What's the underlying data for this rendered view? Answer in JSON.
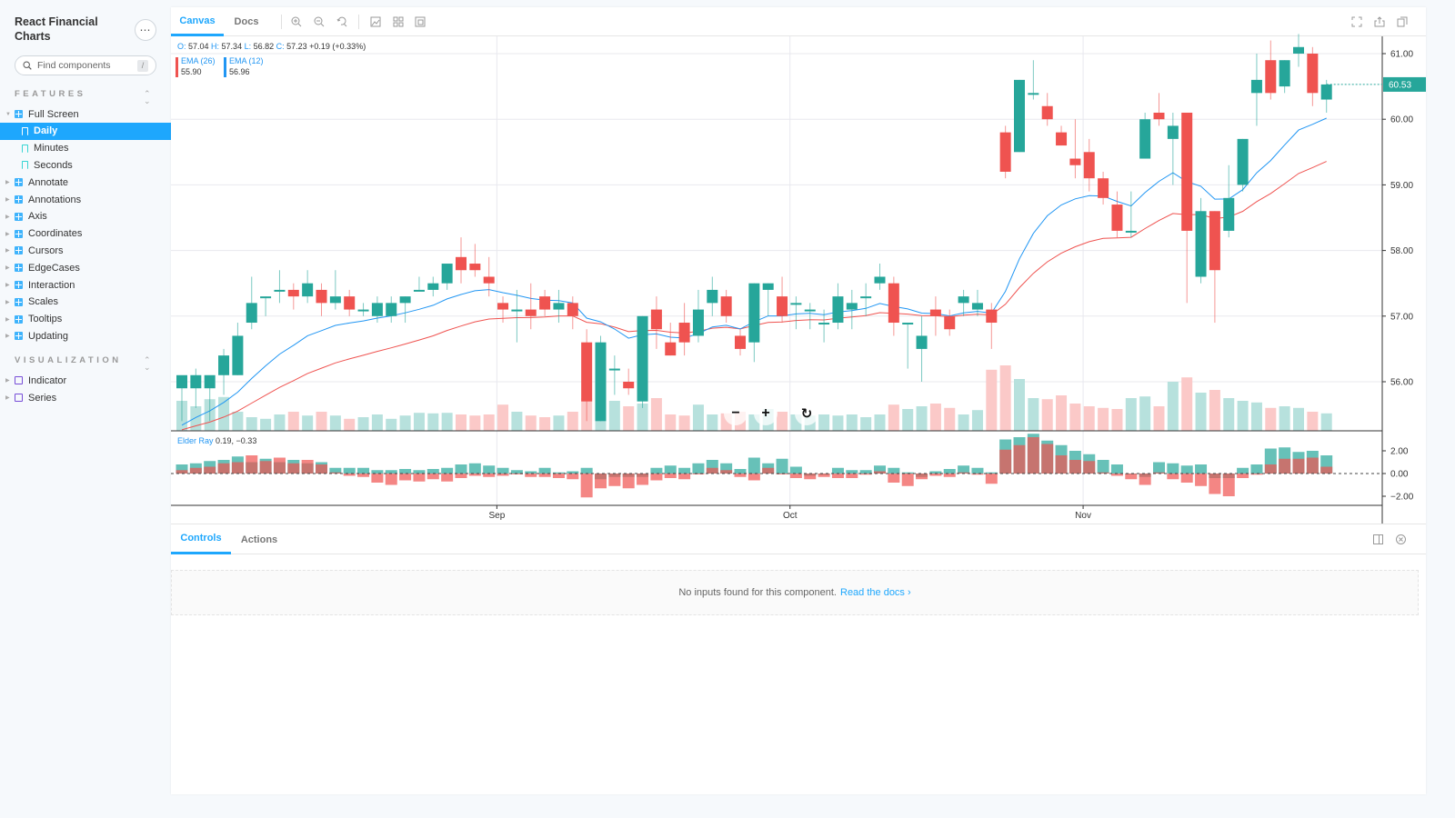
{
  "app": {
    "title": "React Financial Charts",
    "more_label": "⋯",
    "search_placeholder": "Find components",
    "search_shortcut": "/"
  },
  "sidebar": {
    "sections": [
      {
        "title": "FEATURES",
        "items": [
          {
            "label": "Full Screen",
            "type": "component",
            "expanded": true,
            "children": [
              {
                "label": "Daily",
                "type": "story",
                "active": true
              },
              {
                "label": "Minutes",
                "type": "story",
                "active": false
              },
              {
                "label": "Seconds",
                "type": "story",
                "active": false
              }
            ]
          },
          {
            "label": "Annotate",
            "type": "component"
          },
          {
            "label": "Annotations",
            "type": "component"
          },
          {
            "label": "Axis",
            "type": "component"
          },
          {
            "label": "Coordinates",
            "type": "component"
          },
          {
            "label": "Cursors",
            "type": "component"
          },
          {
            "label": "EdgeCases",
            "type": "component"
          },
          {
            "label": "Interaction",
            "type": "component"
          },
          {
            "label": "Scales",
            "type": "component"
          },
          {
            "label": "Tooltips",
            "type": "component"
          },
          {
            "label": "Updating",
            "type": "component"
          }
        ]
      },
      {
        "title": "VISUALIZATION",
        "items": [
          {
            "label": "Indicator",
            "type": "folder"
          },
          {
            "label": "Series",
            "type": "folder"
          }
        ]
      }
    ]
  },
  "toolbar": {
    "tabs": [
      {
        "label": "Canvas",
        "active": true
      },
      {
        "label": "Docs",
        "active": false
      }
    ],
    "icons": [
      "zoom-in-icon",
      "zoom-out-icon",
      "reset-zoom-icon",
      "background-icon",
      "grid-icon",
      "outline-icon"
    ],
    "right_icons": [
      "fullscreen-icon",
      "share-icon",
      "copy-icon"
    ]
  },
  "addons": {
    "tabs": [
      {
        "label": "Controls",
        "active": true
      },
      {
        "label": "Actions",
        "active": false
      }
    ],
    "empty_text": "No inputs found for this component.",
    "docs_link": "Read the docs",
    "docs_chevron": "›"
  },
  "colors": {
    "up": "#26a69a",
    "down": "#ef5350",
    "up_volume": "#b7e1dd",
    "down_volume": "#fbc9c8",
    "ema12": "#2196f3",
    "ema26": "#ef5350",
    "accent": "#1ea7fd"
  },
  "chart_data": {
    "type": "candlestick",
    "title": "",
    "ohlc_tooltip": {
      "o_label": "O:",
      "o": "57.04",
      "h_label": "H:",
      "h": "57.34",
      "l_label": "L:",
      "l": "56.82",
      "c_label": "C:",
      "c": "57.23",
      "change": "+0.19 (+0.33%)"
    },
    "legend": [
      {
        "name": "EMA (26)",
        "value": "55.90",
        "color": "#ef5350"
      },
      {
        "name": "EMA (12)",
        "value": "56.96",
        "color": "#2196f3"
      }
    ],
    "last_price_label": "60.53",
    "y_ticks": [
      "56.00",
      "57.00",
      "58.00",
      "59.00",
      "60.00",
      "61.00"
    ],
    "ylim": [
      55.3,
      61.25
    ],
    "x_ticks": [
      {
        "label": "Sep",
        "index": 23
      },
      {
        "label": "Oct",
        "index": 44
      },
      {
        "label": "Nov",
        "index": 65
      }
    ],
    "elder_ray": {
      "label": "Elder Ray",
      "values": "0.19, −0.33",
      "y_ticks": [
        "2.00",
        "0.00",
        "−2.00"
      ],
      "ylim": [
        -3.0,
        3.1
      ]
    },
    "candles": [
      {
        "o": 55.9,
        "h": 56.0,
        "l": 55.4,
        "c": 56.1
      },
      {
        "o": 55.9,
        "h": 56.2,
        "l": 55.6,
        "c": 56.1
      },
      {
        "o": 55.9,
        "h": 56.0,
        "l": 55.4,
        "c": 56.1
      },
      {
        "o": 56.1,
        "h": 56.5,
        "l": 55.8,
        "c": 56.4
      },
      {
        "o": 56.1,
        "h": 56.9,
        "l": 56.1,
        "c": 56.7
      },
      {
        "o": 56.9,
        "h": 57.6,
        "l": 56.8,
        "c": 57.2
      },
      {
        "o": 57.3,
        "h": 57.3,
        "l": 57.0,
        "c": 57.3
      },
      {
        "o": 57.4,
        "h": 57.7,
        "l": 57.2,
        "c": 57.4
      },
      {
        "o": 57.4,
        "h": 57.5,
        "l": 57.1,
        "c": 57.3
      },
      {
        "o": 57.3,
        "h": 57.7,
        "l": 57.2,
        "c": 57.5
      },
      {
        "o": 57.4,
        "h": 57.5,
        "l": 57.0,
        "c": 57.2
      },
      {
        "o": 57.2,
        "h": 57.7,
        "l": 57.1,
        "c": 57.3
      },
      {
        "o": 57.3,
        "h": 57.4,
        "l": 57.0,
        "c": 57.1
      },
      {
        "o": 57.1,
        "h": 57.2,
        "l": 57.0,
        "c": 57.1
      },
      {
        "o": 57.0,
        "h": 57.3,
        "l": 56.9,
        "c": 57.2
      },
      {
        "o": 57.0,
        "h": 57.3,
        "l": 56.9,
        "c": 57.2
      },
      {
        "o": 57.2,
        "h": 57.3,
        "l": 56.9,
        "c": 57.3
      },
      {
        "o": 57.4,
        "h": 57.6,
        "l": 57.4,
        "c": 57.4
      },
      {
        "o": 57.4,
        "h": 57.6,
        "l": 57.3,
        "c": 57.5
      },
      {
        "o": 57.5,
        "h": 57.8,
        "l": 57.4,
        "c": 57.8
      },
      {
        "o": 57.9,
        "h": 58.2,
        "l": 57.5,
        "c": 57.7
      },
      {
        "o": 57.8,
        "h": 58.1,
        "l": 57.6,
        "c": 57.7
      },
      {
        "o": 57.6,
        "h": 57.9,
        "l": 57.3,
        "c": 57.5
      },
      {
        "o": 57.2,
        "h": 57.3,
        "l": 56.9,
        "c": 57.1
      },
      {
        "o": 57.1,
        "h": 57.4,
        "l": 56.6,
        "c": 57.1
      },
      {
        "o": 57.1,
        "h": 57.5,
        "l": 56.8,
        "c": 57.0
      },
      {
        "o": 57.3,
        "h": 57.4,
        "l": 57.0,
        "c": 57.1
      },
      {
        "o": 57.1,
        "h": 57.4,
        "l": 56.9,
        "c": 57.2
      },
      {
        "o": 57.2,
        "h": 57.3,
        "l": 56.8,
        "c": 57.0
      },
      {
        "o": 56.6,
        "h": 56.8,
        "l": 55.4,
        "c": 55.7
      },
      {
        "o": 55.4,
        "h": 56.7,
        "l": 55.4,
        "c": 56.6
      },
      {
        "o": 56.2,
        "h": 56.4,
        "l": 55.8,
        "c": 56.2
      },
      {
        "o": 56.0,
        "h": 56.2,
        "l": 55.8,
        "c": 55.9
      },
      {
        "o": 55.7,
        "h": 57.0,
        "l": 55.6,
        "c": 57.0
      },
      {
        "o": 57.1,
        "h": 57.3,
        "l": 56.5,
        "c": 56.8
      },
      {
        "o": 56.6,
        "h": 56.9,
        "l": 56.4,
        "c": 56.4
      },
      {
        "o": 56.9,
        "h": 57.2,
        "l": 56.4,
        "c": 56.6
      },
      {
        "o": 56.7,
        "h": 57.4,
        "l": 56.6,
        "c": 57.1
      },
      {
        "o": 57.2,
        "h": 57.6,
        "l": 57.0,
        "c": 57.4
      },
      {
        "o": 57.3,
        "h": 57.4,
        "l": 56.9,
        "c": 57.0
      },
      {
        "o": 56.7,
        "h": 56.8,
        "l": 56.4,
        "c": 56.5
      },
      {
        "o": 56.6,
        "h": 57.5,
        "l": 56.3,
        "c": 57.5
      },
      {
        "o": 57.4,
        "h": 57.5,
        "l": 57.0,
        "c": 57.5
      },
      {
        "o": 57.3,
        "h": 57.6,
        "l": 56.9,
        "c": 57.0
      },
      {
        "o": 57.2,
        "h": 57.3,
        "l": 56.8,
        "c": 57.2
      },
      {
        "o": 57.1,
        "h": 57.2,
        "l": 56.8,
        "c": 57.1
      },
      {
        "o": 56.9,
        "h": 57.1,
        "l": 56.6,
        "c": 56.9
      },
      {
        "o": 56.9,
        "h": 57.5,
        "l": 56.8,
        "c": 57.3
      },
      {
        "o": 57.1,
        "h": 57.4,
        "l": 56.8,
        "c": 57.2
      },
      {
        "o": 57.3,
        "h": 57.5,
        "l": 57.0,
        "c": 57.3
      },
      {
        "o": 57.5,
        "h": 57.8,
        "l": 57.4,
        "c": 57.6
      },
      {
        "o": 57.5,
        "h": 57.6,
        "l": 56.7,
        "c": 56.9
      },
      {
        "o": 56.9,
        "h": 56.9,
        "l": 56.2,
        "c": 56.9
      },
      {
        "o": 56.5,
        "h": 57.0,
        "l": 56.0,
        "c": 56.7
      },
      {
        "o": 57.1,
        "h": 57.3,
        "l": 56.7,
        "c": 57.0
      },
      {
        "o": 57.0,
        "h": 57.1,
        "l": 56.7,
        "c": 56.8
      },
      {
        "o": 57.2,
        "h": 57.4,
        "l": 57.0,
        "c": 57.3
      },
      {
        "o": 57.1,
        "h": 57.4,
        "l": 57.0,
        "c": 57.2
      },
      {
        "o": 57.1,
        "h": 57.2,
        "l": 56.5,
        "c": 56.9
      },
      {
        "o": 59.8,
        "h": 59.9,
        "l": 59.1,
        "c": 59.2
      },
      {
        "o": 59.5,
        "h": 60.6,
        "l": 59.5,
        "c": 60.6
      },
      {
        "o": 60.4,
        "h": 60.9,
        "l": 60.3,
        "c": 60.4
      },
      {
        "o": 60.2,
        "h": 60.4,
        "l": 59.9,
        "c": 60.0
      },
      {
        "o": 59.8,
        "h": 59.9,
        "l": 59.6,
        "c": 59.6
      },
      {
        "o": 59.4,
        "h": 60.0,
        "l": 59.1,
        "c": 59.3
      },
      {
        "o": 59.5,
        "h": 59.7,
        "l": 58.9,
        "c": 59.1
      },
      {
        "o": 59.1,
        "h": 59.2,
        "l": 58.7,
        "c": 58.8
      },
      {
        "o": 58.7,
        "h": 58.9,
        "l": 58.2,
        "c": 58.3
      },
      {
        "o": 58.3,
        "h": 58.9,
        "l": 58.2,
        "c": 58.3
      },
      {
        "o": 59.4,
        "h": 60.1,
        "l": 59.4,
        "c": 60.0
      },
      {
        "o": 60.1,
        "h": 60.4,
        "l": 59.9,
        "c": 60.0
      },
      {
        "o": 59.7,
        "h": 60.1,
        "l": 59.0,
        "c": 59.9
      },
      {
        "o": 60.1,
        "h": 60.1,
        "l": 57.2,
        "c": 58.3
      },
      {
        "o": 57.6,
        "h": 58.8,
        "l": 57.5,
        "c": 58.6
      },
      {
        "o": 58.6,
        "h": 58.6,
        "l": 56.9,
        "c": 57.7
      },
      {
        "o": 58.3,
        "h": 59.3,
        "l": 58.2,
        "c": 58.8
      },
      {
        "o": 59.0,
        "h": 59.7,
        "l": 58.9,
        "c": 59.7
      },
      {
        "o": 60.4,
        "h": 61.0,
        "l": 59.9,
        "c": 60.6
      },
      {
        "o": 60.9,
        "h": 61.2,
        "l": 60.3,
        "c": 60.4
      },
      {
        "o": 60.5,
        "h": 60.9,
        "l": 60.4,
        "c": 60.9
      },
      {
        "o": 61.0,
        "h": 61.3,
        "l": 60.8,
        "c": 61.1
      },
      {
        "o": 61.0,
        "h": 61.1,
        "l": 60.2,
        "c": 60.4
      },
      {
        "o": 60.3,
        "h": 60.6,
        "l": 60.1,
        "c": 60.53
      }
    ],
    "volume": [
      0.55,
      0.45,
      0.58,
      0.62,
      0.35,
      0.25,
      0.22,
      0.3,
      0.35,
      0.28,
      0.35,
      0.28,
      0.22,
      0.25,
      0.3,
      0.22,
      0.28,
      0.33,
      0.32,
      0.33,
      0.3,
      0.28,
      0.3,
      0.48,
      0.35,
      0.28,
      0.25,
      0.28,
      0.35,
      0.6,
      0.5,
      0.55,
      0.45,
      0.5,
      0.6,
      0.3,
      0.28,
      0.48,
      0.3,
      0.32,
      0.35,
      0.3,
      0.4,
      0.35,
      0.3,
      0.28,
      0.3,
      0.28,
      0.3,
      0.25,
      0.3,
      0.48,
      0.4,
      0.45,
      0.5,
      0.42,
      0.3,
      0.38,
      1.12,
      1.2,
      0.95,
      0.6,
      0.58,
      0.65,
      0.5,
      0.45,
      0.42,
      0.4,
      0.6,
      0.63,
      0.45,
      0.9,
      0.98,
      0.7,
      0.75,
      0.6,
      0.55,
      0.52,
      0.42,
      0.45,
      0.42,
      0.35,
      0.32
    ],
    "elder_bull": [
      0.8,
      0.9,
      1.1,
      1.2,
      1.5,
      1.0,
      1.3,
      1.0,
      1.2,
      0.9,
      1.0,
      0.5,
      0.5,
      0.5,
      0.3,
      0.3,
      0.4,
      0.3,
      0.4,
      0.5,
      0.8,
      0.9,
      0.7,
      0.5,
      0.3,
      0.2,
      0.5,
      0.1,
      0.2,
      0.5,
      -0.5,
      -0.3,
      -0.3,
      -0.3,
      0.5,
      0.7,
      0.5,
      0.9,
      1.2,
      0.9,
      0.4,
      1.4,
      0.9,
      1.3,
      0.6,
      -0.2,
      -0.1,
      0.5,
      0.3,
      0.3,
      0.7,
      0.5,
      0.1,
      -0.3,
      0.2,
      0.4,
      0.7,
      0.5,
      0.1,
      3.0,
      3.2,
      3.5,
      2.9,
      2.5,
      2.0,
      1.7,
      1.2,
      0.8,
      0.0,
      -0.3,
      1.0,
      0.9,
      0.7,
      0.8,
      -0.4,
      -0.4,
      0.5,
      0.8,
      2.2,
      2.3,
      1.9,
      2.0,
      1.6,
      0.6
    ],
    "elder_bear": [
      0.3,
      0.5,
      0.6,
      0.9,
      1.0,
      1.6,
      1.1,
      1.4,
      0.9,
      1.2,
      0.8,
      0.1,
      -0.2,
      -0.3,
      -0.8,
      -1.0,
      -0.6,
      -0.7,
      -0.5,
      -0.7,
      -0.4,
      -0.2,
      -0.3,
      -0.2,
      0.0,
      -0.3,
      -0.3,
      -0.4,
      -0.5,
      -2.1,
      -1.3,
      -1.1,
      -1.3,
      -1.0,
      -0.6,
      -0.4,
      -0.5,
      0.0,
      0.5,
      0.3,
      -0.3,
      -0.6,
      0.5,
      0.0,
      -0.4,
      -0.5,
      -0.3,
      -0.4,
      -0.4,
      -0.1,
      0.2,
      -0.8,
      -1.1,
      -0.5,
      -0.2,
      -0.3,
      0.1,
      -0.1,
      -0.9,
      2.1,
      2.5,
      3.2,
      2.6,
      1.6,
      1.2,
      1.1,
      0.1,
      -0.2,
      -0.5,
      -1.0,
      0.1,
      -0.5,
      -0.8,
      -1.1,
      -1.8,
      -2.0,
      -0.4,
      -0.1,
      0.8,
      1.3,
      1.3,
      1.4,
      0.6,
      0.2
    ]
  }
}
